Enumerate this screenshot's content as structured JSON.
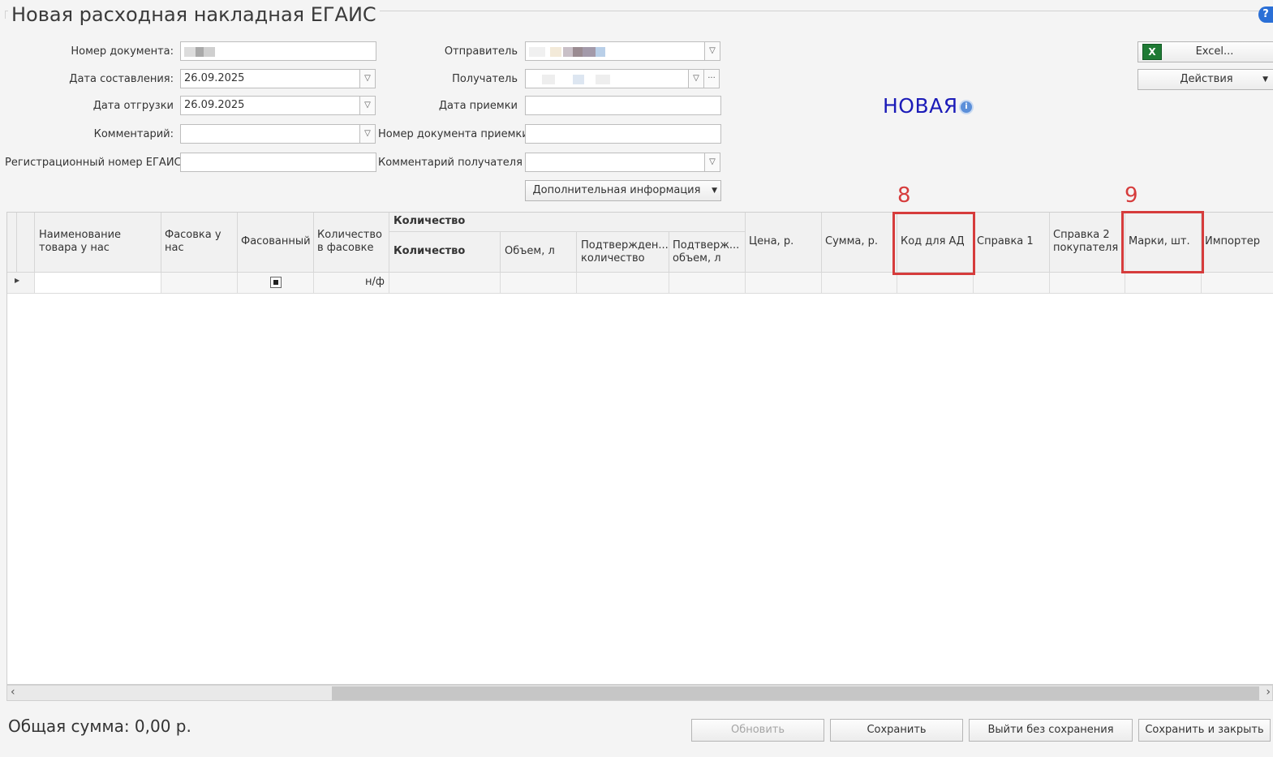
{
  "window": {
    "title": "Новая расходная накладная ЕГАИС"
  },
  "form": {
    "doc_number_label": "Номер документа:",
    "created_date_label": "Дата составления:",
    "created_date_value": "26.09.2025",
    "shipment_date_label": "Дата отгрузки",
    "shipment_date_value": "26.09.2025",
    "comment_label": "Комментарий:",
    "egais_reg_label": "Регистрационный номер ЕГАИС:",
    "sender_label": "Отправитель",
    "recipient_label": "Получатель",
    "acceptance_date_label": "Дата приемки",
    "acceptance_doc_label": "Номер документа приемки",
    "recipient_comment_label": "Комментарий получателя",
    "more_info_button": "Дополнительная информация"
  },
  "status": {
    "text": "НОВАЯ"
  },
  "actions": {
    "excel_label": "Excel...",
    "actions_label": "Действия"
  },
  "grid": {
    "group_header": "Количество",
    "columns": {
      "name": "Наименование товара у нас",
      "pack_ours": "Фасовка у нас",
      "packaged": "Фасованный",
      "qty_in_pack": "Количество в фасовке",
      "qty": "Количество",
      "volume": "Объем, л",
      "confirmed_qty": "Подтвержден... количество",
      "confirmed_vol": "Подтверж... объем, л",
      "price": "Цена, р.",
      "sum": "Сумма, р.",
      "ad_code": "Код для АД",
      "cert1": "Справка 1",
      "cert2": "Справка 2 покупателя",
      "marks": "Марки, шт.",
      "importer": "Импортер"
    },
    "row": {
      "qty_in_pack": "н/ф",
      "packaged": true
    }
  },
  "annotations": {
    "n8": "8",
    "n9": "9"
  },
  "footer": {
    "total_text": "Общая сумма: 0,00 р.",
    "refresh": "Обновить",
    "save": "Сохранить",
    "exit_no_save": "Выйти без сохранения",
    "save_close": "Сохранить и закрыть"
  },
  "colors": {
    "status": "#1b1bb8",
    "annotation": "#d63c3c"
  }
}
